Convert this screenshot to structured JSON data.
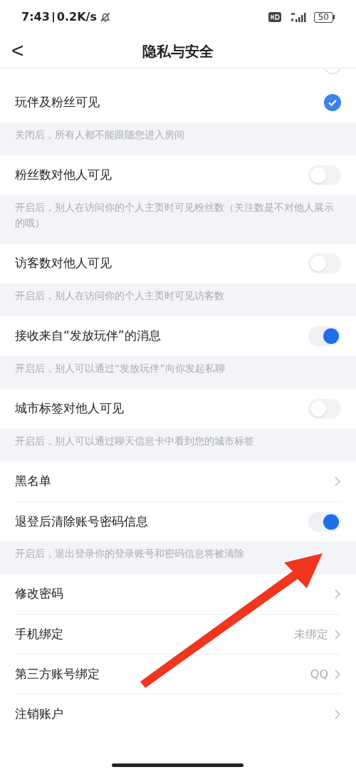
{
  "status_bar": {
    "time": "7:43",
    "speed": "0.2K/s",
    "battery": "50"
  },
  "header": {
    "back": "<",
    "title": "隐私与安全"
  },
  "sections": [
    {
      "items": [
        {
          "kind": "radio",
          "selected": false,
          "cut": true
        },
        {
          "kind": "radio",
          "label": "玩伴及粉丝可见",
          "selected": true
        }
      ],
      "hint": "关闭后，所有人都不能跟随您进入房间"
    },
    {
      "items": [
        {
          "kind": "toggle",
          "label": "粉丝数对他人可见",
          "on": false
        }
      ],
      "hint": "开启后，别人在访问你的个人主页时可见粉丝数（关注数是不对他人展示的哦）"
    },
    {
      "items": [
        {
          "kind": "toggle",
          "label": "访客数对他人可见",
          "on": false
        }
      ],
      "hint": "开启后，别人在访问你的个人主页时可见访客数"
    },
    {
      "items": [
        {
          "kind": "toggle",
          "label": "接收来自“发放玩伴”的消息",
          "on": true
        }
      ],
      "hint": "开启后，别人可以通过“发放玩伴”向你发起私聊"
    },
    {
      "items": [
        {
          "kind": "toggle",
          "label": "城市标签对他人可见",
          "on": false
        }
      ],
      "hint": "开启后，别人可以通过聊天信息卡中看到您的城市标签"
    },
    {
      "items": [
        {
          "kind": "link",
          "label": "黑名单"
        },
        {
          "kind": "toggle",
          "label": "退登后清除账号密码信息",
          "on": true
        }
      ],
      "hint": "开启后，退出登录你的登录账号和密码信息将被清除"
    },
    {
      "items": [
        {
          "kind": "link",
          "label": "修改密码"
        },
        {
          "kind": "link",
          "label": "手机绑定",
          "value": "未绑定"
        },
        {
          "kind": "link",
          "label": "第三方账号绑定",
          "value": "QQ"
        },
        {
          "kind": "link",
          "label": "注销账户"
        }
      ]
    }
  ],
  "annotation": {
    "kind": "arrow"
  }
}
